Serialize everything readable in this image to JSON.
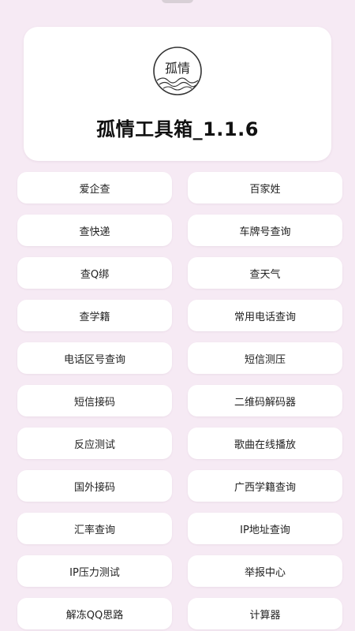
{
  "header": {
    "title": "孤情工具箱_1.1.6",
    "logo_text": "孤情"
  },
  "tools": [
    "爱企查",
    "百家姓",
    "查快递",
    "车牌号查询",
    "查Q绑",
    "查天气",
    "查学籍",
    "常用电话查询",
    "电话区号查询",
    "短信测压",
    "短信接码",
    "二维码解码器",
    "反应测试",
    "歌曲在线播放",
    "国外接码",
    "广西学籍查询",
    "汇率查询",
    "IP地址查询",
    "IP压力测试",
    "举报中心",
    "解冻QQ思路",
    "计算器"
  ],
  "colors": {
    "background": "#f6eaf4",
    "card": "#ffffff",
    "text": "#222222"
  }
}
